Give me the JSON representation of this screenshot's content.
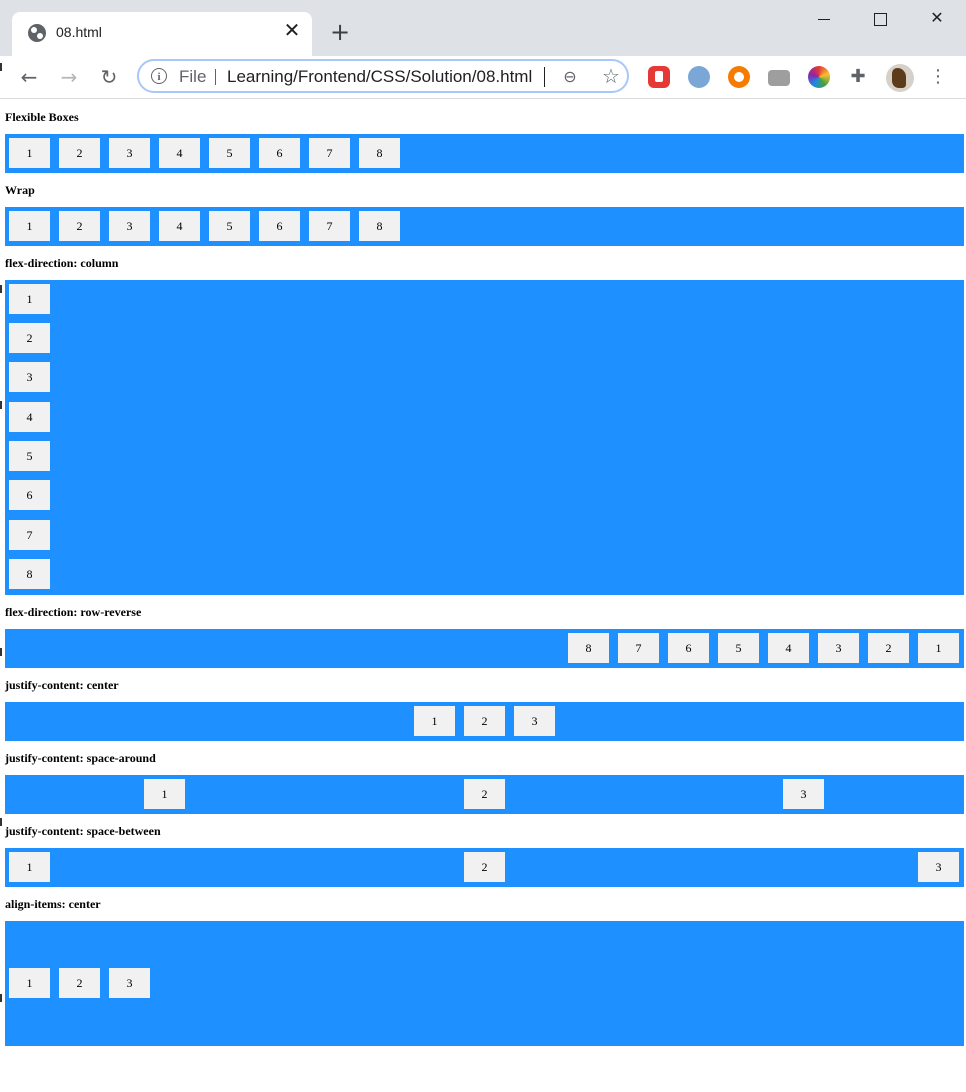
{
  "browser": {
    "tab_title": "08.html",
    "close_glyph": "✕",
    "new_tab_glyph": "+",
    "file_label": "File",
    "url": "Learning/Frontend/CSS/Solution/08.html",
    "extensions": [
      "stop-extension-icon",
      "drop-extension-icon",
      "orange-extension-icon",
      "camera-extension-icon",
      "colorwheel-extension-icon",
      "puzzle-extensions-icon"
    ]
  },
  "sections": [
    {
      "heading": "Flexible Boxes",
      "items": [
        "1",
        "2",
        "3",
        "4",
        "5",
        "6",
        "7",
        "8"
      ]
    },
    {
      "heading": "Wrap",
      "items": [
        "1",
        "2",
        "3",
        "4",
        "5",
        "6",
        "7",
        "8"
      ]
    },
    {
      "heading": "flex-direction: column",
      "items": [
        "1",
        "2",
        "3",
        "4",
        "5",
        "6",
        "7",
        "8"
      ]
    },
    {
      "heading": "flex-direction: row-reverse",
      "items": [
        "8",
        "7",
        "6",
        "5",
        "4",
        "3",
        "2",
        "1"
      ]
    },
    {
      "heading": "justify-content: center",
      "items": [
        "1",
        "2",
        "3"
      ]
    },
    {
      "heading": "justify-content: space-around",
      "items": [
        "1",
        "2",
        "3"
      ]
    },
    {
      "heading": "justify-content: space-between",
      "items": [
        "1",
        "2",
        "3"
      ]
    },
    {
      "heading": "align-items: center",
      "items": [
        "1",
        "2",
        "3"
      ]
    }
  ],
  "colors": {
    "container": "#1e90ff",
    "item": "#f1f1f1"
  }
}
